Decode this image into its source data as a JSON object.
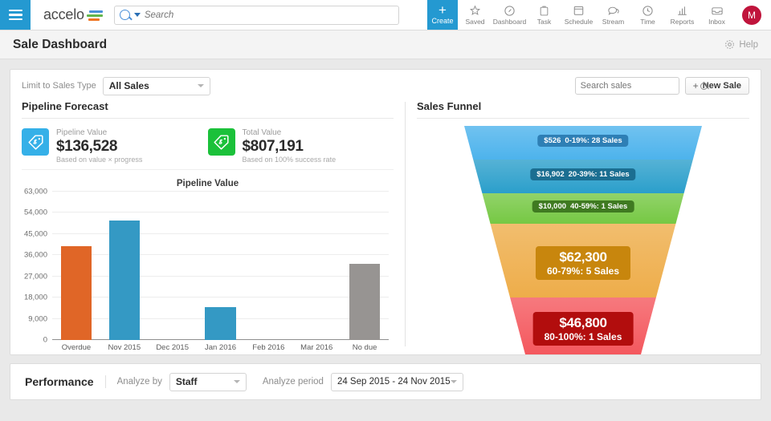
{
  "topnav": {
    "menu_icon": "hamburger-icon",
    "logo_text": "accelo",
    "search": {
      "placeholder": "Search",
      "value": ""
    },
    "create": {
      "label": "Create",
      "icon": "plus-icon"
    },
    "items": [
      {
        "label": "Saved",
        "icon": "star-icon"
      },
      {
        "label": "Dashboard",
        "icon": "gauge-icon"
      },
      {
        "label": "Task",
        "icon": "clipboard-icon"
      },
      {
        "label": "Schedule",
        "icon": "calendar-icon"
      },
      {
        "label": "Stream",
        "icon": "speech-bubble-icon"
      },
      {
        "label": "Time",
        "icon": "clock-icon"
      },
      {
        "label": "Reports",
        "icon": "bar-chart-icon"
      },
      {
        "label": "Inbox",
        "icon": "inbox-icon"
      }
    ],
    "avatar": {
      "initial": "M",
      "color": "#c0143c"
    }
  },
  "titlebar": {
    "title": "Sale Dashboard",
    "help_label": "Help",
    "help_icon": "gear-icon"
  },
  "filters": {
    "sales_type_label": "Limit to Sales Type",
    "sales_type_value": "All Sales",
    "search_sales_placeholder": "Search sales",
    "search_sales_value": "",
    "new_sale_label": "New Sale",
    "new_sale_plus": "+"
  },
  "pipeline": {
    "section_title": "Pipeline Forecast",
    "kpis": [
      {
        "caption": "Pipeline Value",
        "value": "$136,528",
        "sub": "Based on value × progress",
        "color": "#35b0e8",
        "icon": "price-tag-icon"
      },
      {
        "caption": "Total Value",
        "value": "$807,191",
        "sub": "Based on 100% success rate",
        "color": "#1bc13a",
        "icon": "price-tag-icon"
      }
    ]
  },
  "funnel_section": {
    "section_title": "Sales Funnel"
  },
  "performance": {
    "title": "Performance",
    "analyze_by_label": "Analyze by",
    "analyze_by_value": "Staff",
    "analyze_period_label": "Analyze period",
    "analyze_period_value": "24 Sep 2015 - 24 Nov 2015"
  },
  "chart_data": [
    {
      "type": "bar",
      "title": "Pipeline Value",
      "xlabel": "",
      "ylabel": "",
      "categories": [
        "Overdue",
        "Nov 2015",
        "Dec 2015",
        "Jan 2016",
        "Feb 2016",
        "Mar 2016",
        "No due"
      ],
      "values": [
        39700,
        50800,
        0,
        13900,
        0,
        0,
        32300
      ],
      "colors": [
        "#e06627",
        "#3499c4",
        "#3499c4",
        "#3499c4",
        "#3499c4",
        "#3499c4",
        "#979492"
      ],
      "ylim": [
        0,
        63000
      ],
      "yticks": [
        0,
        9000,
        18000,
        27000,
        36000,
        45000,
        54000,
        63000
      ],
      "ytick_labels": [
        "0",
        "9,000",
        "18,000",
        "27,000",
        "36,000",
        "45,000",
        "54,000",
        "63,000"
      ],
      "grid": true,
      "legend": "none"
    },
    {
      "type": "funnel",
      "title": "Sales Funnel",
      "stages": [
        {
          "amount": "$526",
          "detail": "0-19%: 28 Sales",
          "range": "0-19%",
          "sales": 28,
          "value": 526,
          "color": "#4db3ec",
          "label_bg": "#2e7fb5",
          "emphasis": "small"
        },
        {
          "amount": "$16,902",
          "detail": "20-39%: 11 Sales",
          "range": "20-39%",
          "sales": 11,
          "value": 16902,
          "color": "#2b9fcb",
          "label_bg": "#1b6e91",
          "emphasis": "small"
        },
        {
          "amount": "$10,000",
          "detail": "40-59%: 1 Sales",
          "range": "40-59%",
          "sales": 1,
          "value": 10000,
          "color": "#76c844",
          "label_bg": "#3f7a21",
          "emphasis": "small"
        },
        {
          "amount": "$62,300",
          "detail": "60-79%: 5 Sales",
          "range": "60-79%",
          "sales": 5,
          "value": 62300,
          "color": "#eead4a",
          "label_bg": "#c8860d",
          "emphasis": "big"
        },
        {
          "amount": "$46,800",
          "detail": "80-100%: 1 Sales",
          "range": "80-100%",
          "sales": 1,
          "value": 46800,
          "color": "#f4585e",
          "label_bg": "#b20d0d",
          "emphasis": "big"
        }
      ]
    }
  ]
}
